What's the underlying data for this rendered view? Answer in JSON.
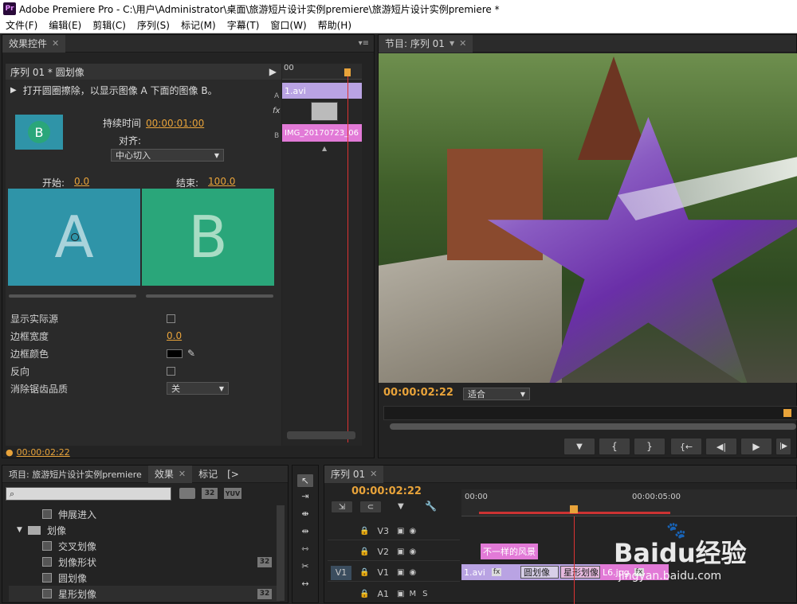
{
  "app": {
    "logo": "Pr",
    "title": "Adobe Premiere Pro - C:\\用户\\Administrator\\桌面\\旅游短片设计实例premiere\\旅游短片设计实例premiere *"
  },
  "menu": [
    "文件(F)",
    "编辑(E)",
    "剪辑(C)",
    "序列(S)",
    "标记(M)",
    "字幕(T)",
    "窗口(W)",
    "帮助(H)"
  ],
  "effect_controls": {
    "tab": "效果控件",
    "clip_label": "序列 01 * 圆划像",
    "description": "打开圆圈擦除，以显示图像 A 下面的图像 B。",
    "duration_label": "持续时间",
    "duration_value": "00:00:01:00",
    "align_label": "对齐:",
    "align_value": "中心切入",
    "start_label": "开始:",
    "start_value": "0.0",
    "end_label": "结束:",
    "end_value": "100.0",
    "preview_a": "A",
    "preview_b": "B",
    "thumb_letter": "B",
    "props": {
      "show_source": "显示实际源",
      "border_width": "边框宽度",
      "border_width_value": "0.0",
      "border_color": "边框颜色",
      "reverse": "反向",
      "antialias": "消除锯齿品质",
      "antialias_value": "关"
    },
    "timecode": "00:00:02:22",
    "mini_timeline": {
      "ruler": "00",
      "track_a": "A",
      "track_b": "B",
      "fx": "fx",
      "clip_a": "1.avi",
      "clip_b": "IMG_20170723_06"
    }
  },
  "program_monitor": {
    "tab": "节目: 序列 01",
    "timecode": "00:00:02:22",
    "fit_value": "适合",
    "controls": [
      "▼",
      "{",
      "}",
      "{←",
      "◀|",
      "▶",
      "|▶"
    ]
  },
  "project_panel": {
    "tabs": [
      "项目: 旅游短片设计实例premiere",
      "效果",
      "标记",
      "[>"
    ],
    "search_placeholder": "",
    "badges": [
      "32",
      "YUV"
    ],
    "items": [
      {
        "label": "伸展进入",
        "indent": 2
      },
      {
        "label": "划像",
        "indent": 1,
        "folder": true
      },
      {
        "label": "交叉划像",
        "indent": 2
      },
      {
        "label": "划像形状",
        "indent": 2,
        "badge": "32"
      },
      {
        "label": "圆划像",
        "indent": 2
      },
      {
        "label": "星形划像",
        "indent": 2,
        "badge": "32"
      }
    ]
  },
  "timeline": {
    "tab": "序列 01",
    "timecode": "00:00:02:22",
    "ruler_start": "00:00",
    "ruler_mid": "00:00:05:00",
    "tracks": [
      {
        "name": "V3"
      },
      {
        "name": "V2"
      },
      {
        "name": "V1",
        "source": "V1"
      },
      {
        "name": "A1",
        "source": ""
      }
    ],
    "clips": {
      "v2_title": "不一样的风景",
      "v1_avi": "1.avi",
      "v1_fx": "fx",
      "trans_circle": "圆划像",
      "trans_star": "星形划像",
      "v1_jpg": "L6.jpg",
      "v1_jpg_fx": "fx"
    },
    "audio_labels": [
      "M",
      "S"
    ]
  },
  "watermark": {
    "text": "Baidu经验",
    "url": "jingyan.baidu.com"
  },
  "colors": {
    "accent": "#e8a33a",
    "clip_video": "#b9a3e3",
    "clip_pink": "#e27ad7",
    "preview_a": "#2f94a8",
    "preview_b": "#2aa67a"
  }
}
